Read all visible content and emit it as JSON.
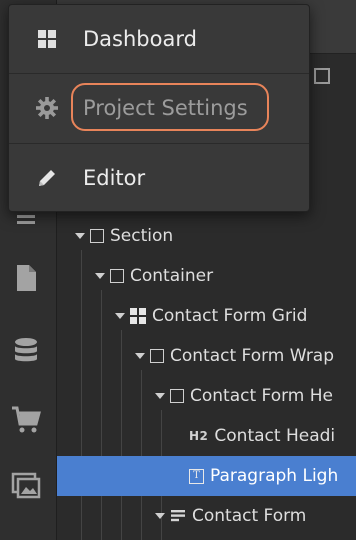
{
  "menu": {
    "items": [
      {
        "label": "Dashboard",
        "icon": "grid-icon"
      },
      {
        "label": "Project Settings",
        "icon": "gear-icon",
        "active": true,
        "highlighted": true
      },
      {
        "label": "Editor",
        "icon": "pencil-icon"
      }
    ]
  },
  "rail": {
    "icons": [
      "menu-icon",
      "page-icon",
      "database-icon",
      "cart-icon",
      "assets-icon"
    ]
  },
  "navigator": {
    "items": [
      {
        "label": "Section",
        "icon": "square-icon",
        "caret": true,
        "selected": false
      },
      {
        "label": "Container",
        "icon": "square-icon",
        "caret": true,
        "selected": false
      },
      {
        "label": "Contact Form Grid",
        "icon": "grid-icon",
        "caret": true,
        "selected": false
      },
      {
        "label": "Contact Form Wrap",
        "icon": "square-icon",
        "caret": true,
        "selected": false
      },
      {
        "label": "Contact Form He",
        "icon": "square-icon",
        "caret": true,
        "selected": false
      },
      {
        "label": "Contact Headi",
        "icon": "heading-icon",
        "icon_text": "H2",
        "caret": false,
        "selected": false
      },
      {
        "label": "Paragraph Ligh",
        "icon": "text-icon",
        "icon_text": "T",
        "caret": false,
        "selected": true
      },
      {
        "label": "Contact Form",
        "icon": "form-icon",
        "caret": true,
        "selected": false
      }
    ]
  },
  "colors": {
    "selection": "#4a7fd0",
    "highlight_ring": "#e8845a",
    "menu_bg": "#393939",
    "panel_bg": "#2b2b2b"
  }
}
